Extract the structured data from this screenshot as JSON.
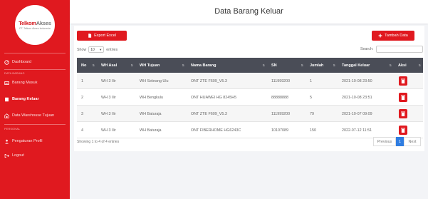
{
  "sidebar": {
    "logo_main": "Telkom",
    "logo_accent": "Akses",
    "logo_sub": "PT. Telkom Akses Indonesia",
    "items": [
      {
        "label": "Dashboard",
        "icon": "dashboard-icon"
      },
      {
        "label": "Barang Masuk",
        "icon": "inbox-icon"
      },
      {
        "label": "Barang Keluar",
        "icon": "box-out-icon",
        "active": true
      },
      {
        "label": "Data Warehouse Tujuan",
        "icon": "warehouse-icon"
      },
      {
        "label": "Pengaturan Profil",
        "icon": "user-icon"
      },
      {
        "label": "Logout",
        "icon": "logout-icon"
      }
    ],
    "heading_data": "DATA BARANG",
    "heading_personal": "PERSONAL"
  },
  "header": {
    "title": "Data Barang Keluar"
  },
  "toolbar": {
    "export_label": "Export Excel",
    "add_label": "Tambah Data"
  },
  "list_controls": {
    "show_label": "Show",
    "entries_value": "10",
    "entries_label": "entries",
    "search_label": "Search:",
    "search_value": ""
  },
  "table": {
    "columns": [
      "No",
      "WH Asal",
      "WH Tujuan",
      "Nama Barang",
      "SN",
      "Jumlah",
      "Tanggal Keluar",
      "Aksi"
    ],
    "rows": [
      {
        "no": "1",
        "wh_asal": "WH 3 Ilir",
        "wh_tujuan": "WH Sebrang Ulu",
        "nama": "ONT ZTE F609_V5.3",
        "sn": "111999200",
        "jumlah": "1",
        "tanggal": "2021-10-08 23:50"
      },
      {
        "no": "2",
        "wh_asal": "WH 3 Ilir",
        "wh_tujuan": "WH Bengkulu",
        "nama": "ONT HUAWEI HG 8245H5",
        "sn": "88888888",
        "jumlah": "5",
        "tanggal": "2021-10-08 23:51"
      },
      {
        "no": "3",
        "wh_asal": "WH 3 Ilir",
        "wh_tujuan": "WH Baturaja",
        "nama": "ONT ZTE F609_V5.3",
        "sn": "111999200",
        "jumlah": "79",
        "tanggal": "2021-10-07 09:09"
      },
      {
        "no": "4",
        "wh_asal": "WH 3 Ilir",
        "wh_tujuan": "WH Baturaja",
        "nama": "ONT FIBERHOME HG6243C",
        "sn": "10107089",
        "jumlah": "150",
        "tanggal": "2022-07-12 11:51"
      }
    ]
  },
  "footer": {
    "info": "Showing 1 to 4 of 4 entries",
    "prev_label": "Previous",
    "page": "1",
    "next_label": "Next"
  },
  "colors": {
    "brand_red": "#e0191f",
    "table_header": "#4a4d57",
    "pager_active": "#2f7de1"
  }
}
